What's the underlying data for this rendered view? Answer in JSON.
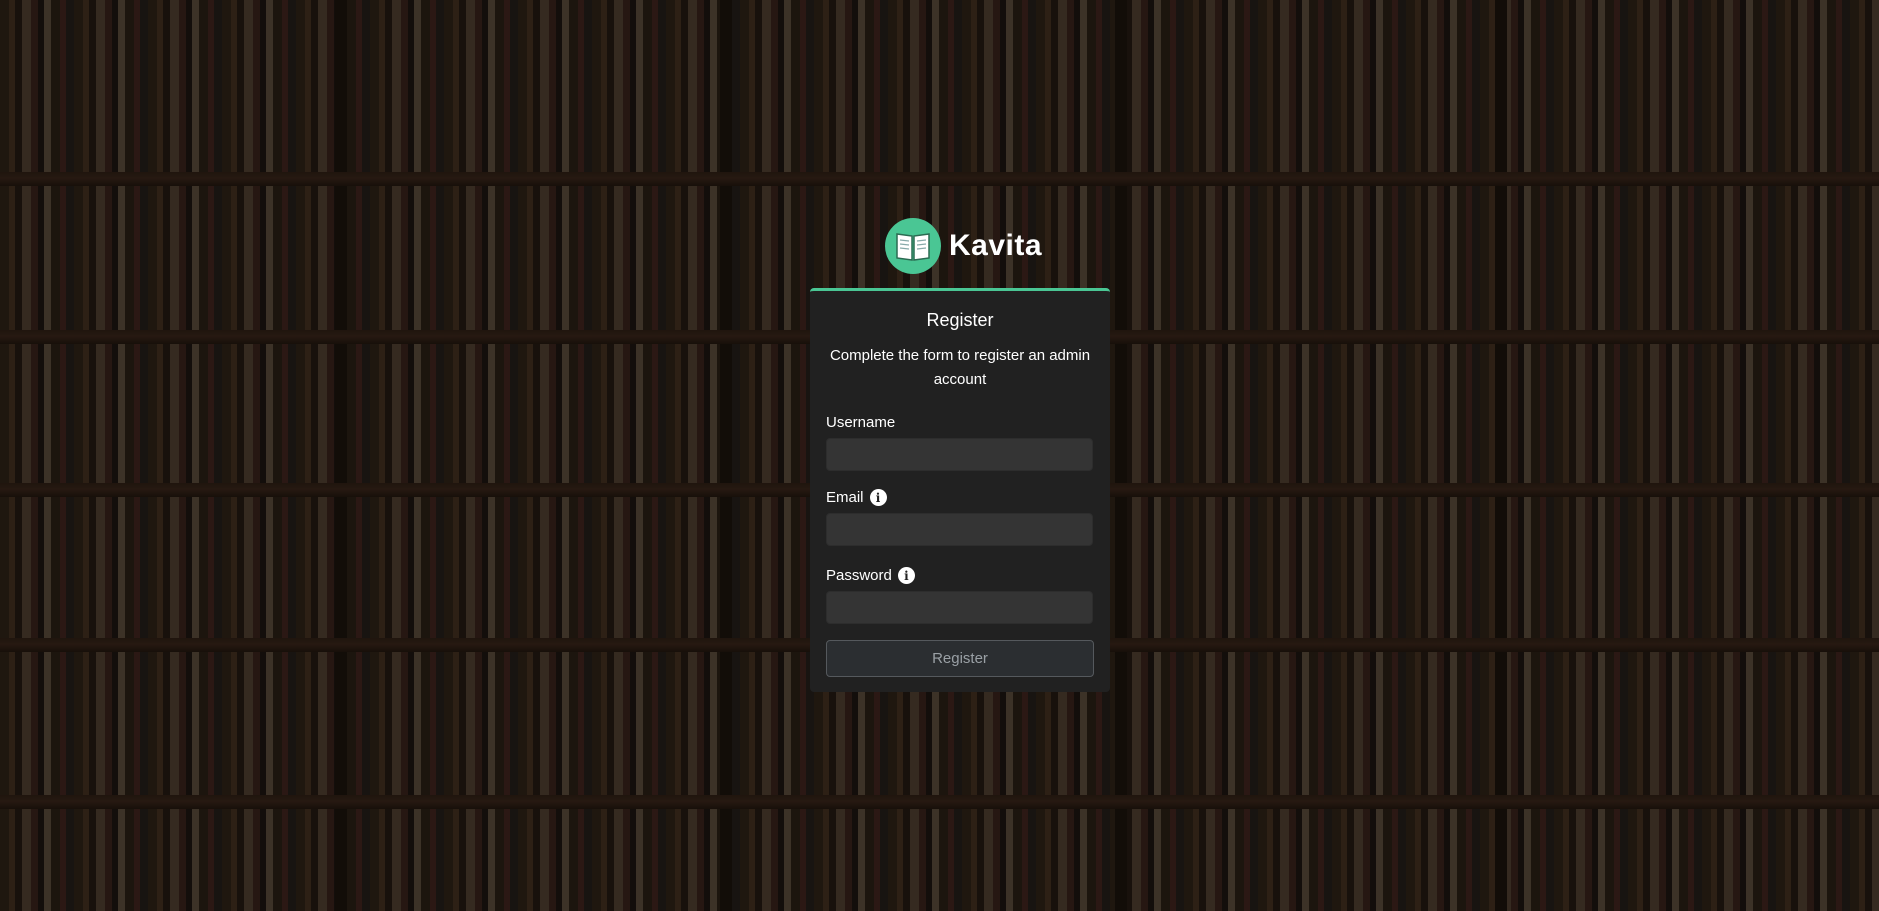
{
  "app": {
    "name": "Kavita",
    "brand_color": "#4ac694",
    "logo_icon": "open-book-icon"
  },
  "register": {
    "title": "Register",
    "subtitle": "Complete the form to register an admin account",
    "fields": {
      "username": {
        "label": "Username",
        "value": ""
      },
      "email": {
        "label": "Email",
        "value": "",
        "info_icon": "info-icon"
      },
      "password": {
        "label": "Password",
        "value": "",
        "info_icon": "info-icon"
      }
    },
    "submit_label": "Register"
  }
}
